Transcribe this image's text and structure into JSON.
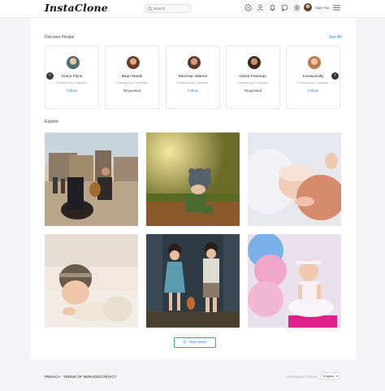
{
  "app": {
    "logo": "InstaClone"
  },
  "header": {
    "search_placeholder": "Search",
    "signout_label": "Sign Out",
    "icons": [
      "compass-icon",
      "user-icon",
      "bell-icon",
      "chat-icon",
      "settings-icon",
      "menu-icon"
    ]
  },
  "discover": {
    "title": "Discover People",
    "see_all": "See All",
    "people": [
      {
        "name": "Grace Flynn",
        "sub": "Followed by 0 member",
        "action": "Follow"
      },
      {
        "name": "Brian Marsh",
        "sub": "Followed by 0 member",
        "action": "Requested"
      },
      {
        "name": "Sherman Warner",
        "sub": "Followed by 0 member",
        "action": "Follow"
      },
      {
        "name": "David Freeman",
        "sub": "Followed by 0 member",
        "action": "Requested"
      },
      {
        "name": "Louisa Kelly",
        "sub": "Followed by 0 member",
        "action": "Follow"
      }
    ]
  },
  "explore": {
    "title": "Explore",
    "view_more": "View More"
  },
  "footer": {
    "privacy": "PRIVACY",
    "terms": "TERMS OF SERVICE",
    "contact": "CONTACT",
    "copyright": "COPYRIGHT © 2019",
    "language": "English"
  },
  "colors": {
    "accent": "#2a7de1",
    "background": "#f4f4f6",
    "card_border": "#e6e6e6"
  }
}
